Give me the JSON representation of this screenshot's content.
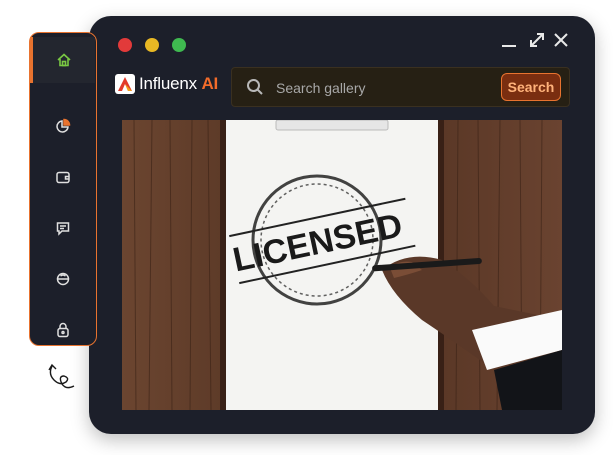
{
  "app": {
    "brand": "Influenx",
    "brand_suffix": "AI"
  },
  "search": {
    "placeholder": "Search gallery",
    "button_label": "Search"
  },
  "hero": {
    "stamp_text": "LICENSED"
  },
  "sidebar": {
    "items": [
      {
        "icon": "home-icon",
        "active": true
      },
      {
        "icon": "pie-chart-icon",
        "active": false
      },
      {
        "icon": "wallet-icon",
        "active": false
      },
      {
        "icon": "chat-icon",
        "active": false
      },
      {
        "icon": "support-icon",
        "active": false
      },
      {
        "icon": "lock-icon",
        "active": false
      }
    ]
  },
  "colors": {
    "accent": "#e8732f",
    "window_bg": "#1c1f2a",
    "traffic_red": "#e23a3a",
    "traffic_yellow": "#e8b824",
    "traffic_green": "#3fb950",
    "active_icon": "#7ac943"
  }
}
